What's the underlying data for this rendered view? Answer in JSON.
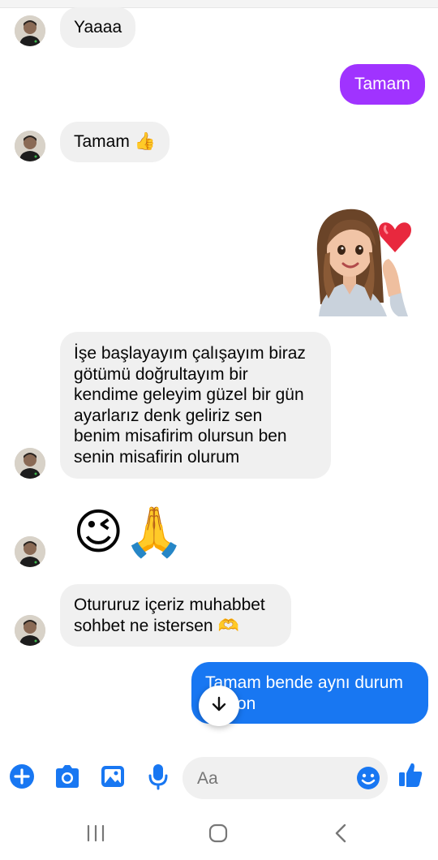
{
  "messages": [
    {
      "id": "m1",
      "text": "Yaaaa"
    },
    {
      "id": "m2",
      "text": "Tamam"
    },
    {
      "id": "m3",
      "text": "Tamam 👍"
    },
    {
      "id": "m4",
      "lines": [
        "İşe başlayayım çalışayım biraz",
        "götümü doğrultayım bir",
        "kendime geleyim güzel bir gün",
        "ayarlarız denk geliriz sen",
        "benim misafirim olursun ben",
        "senin misafirin olurum"
      ]
    },
    {
      "id": "m5",
      "emoji": [
        "😉",
        "🙏"
      ]
    },
    {
      "id": "m6",
      "lines": [
        "Otururuz içeriz muhabbet",
        "sohbet ne istersen 🫶"
      ]
    },
    {
      "id": "m7",
      "lines": [
        "Tamam bende aynı durum",
        "on"
      ]
    }
  ],
  "composer": {
    "placeholder": "Aa",
    "icons": [
      "plus-icon",
      "camera-icon",
      "image-icon",
      "microphone-icon",
      "emoji-icon",
      "thumbs-up-icon"
    ]
  },
  "colors": {
    "accent_blue": "#1877f2",
    "outgoing_purple": "#a033ff",
    "incoming_gray": "#f0f0f0"
  },
  "navbar": {
    "icons": [
      "recent-apps-icon",
      "home-icon",
      "back-icon"
    ]
  }
}
